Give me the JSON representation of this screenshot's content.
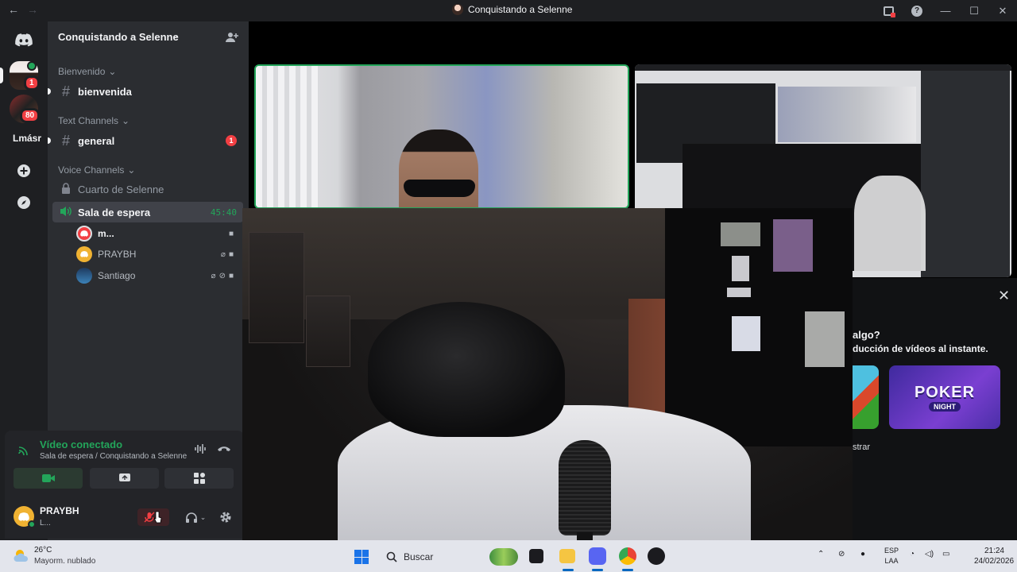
{
  "window": {
    "title": "Conquistando a Selenne",
    "nav_back": "←",
    "nav_forward": "→",
    "minimize": "—",
    "maximize": "☐",
    "close": "✕",
    "help": "?"
  },
  "rail": {
    "server1_badge": "1",
    "server2_badge": "80",
    "folder_text": "Lmásr"
  },
  "guild": {
    "name": "Conquistando a Selenne",
    "chevron": "⌄"
  },
  "categories": {
    "bienvenido": "Bienvenido",
    "text_channels": "Text Channels",
    "voice_channels": "Voice Channels"
  },
  "channels": {
    "bienvenida": "bienvenida",
    "general": "general",
    "general_badge": "1",
    "cuarto": "Cuarto de Selenne",
    "sala": "Sala de espera",
    "sala_timer": "45:40"
  },
  "members": [
    {
      "name": "m..."
    },
    {
      "name": "PRAYBH"
    },
    {
      "name": "Santiago"
    }
  ],
  "voice_panel": {
    "title": "Vídeo conectado",
    "subtitle": "Sala de espera / Conquistando a Selenne"
  },
  "user": {
    "name": "PRAYBH",
    "status": "L..."
  },
  "modal": {
    "close": "✕",
    "line1": "algo?",
    "line2": "ducción de vídeos al instante.",
    "poker": "POKER",
    "night": "NIGHT",
    "line3": "strar"
  },
  "taskbar": {
    "temp": "26°C",
    "weather": "Mayorm. nublado",
    "search_label": "Buscar",
    "lang1": "ESP",
    "lang2": "LAA",
    "time": "21:24",
    "date": "24/02/2026"
  },
  "colors": {
    "green": "#23a55a",
    "red": "#f23f43",
    "sidebar": "#2b2d31",
    "rail": "#1e1f22"
  }
}
